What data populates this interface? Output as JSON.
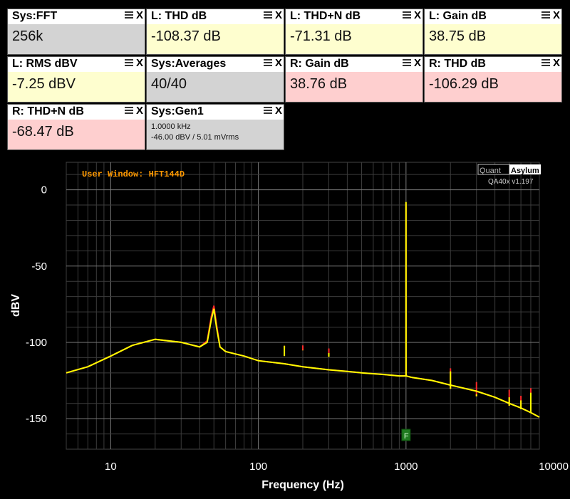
{
  "widgets": [
    {
      "title": "Sys:FFT",
      "value": "256k"
    },
    {
      "title": "L: THD dB",
      "value": "-108.37 dB"
    },
    {
      "title": "L: THD+N dB",
      "value": "-71.31 dB"
    },
    {
      "title": "L: Gain dB",
      "value": "38.75 dB"
    },
    {
      "title": "L: RMS dBV",
      "value": "-7.25 dBV"
    },
    {
      "title": "Sys:Averages",
      "value": "40/40"
    },
    {
      "title": "R: Gain dB",
      "value": "38.76 dB"
    },
    {
      "title": "R: THD dB",
      "value": "-106.29 dB"
    },
    {
      "title": "R: THD+N dB",
      "value": "-68.47 dB"
    },
    {
      "title": "Sys:Gen1",
      "line1": "1.0000 kHz",
      "line2": "-46.00 dBV  / 5.01 mVrms"
    }
  ],
  "close_glyph": "X",
  "colors": {
    "gray": "#d3d3d3",
    "yellow": "#fefecf",
    "pink": "#fecfcf",
    "left_trace": "#ffff00",
    "right_trace": "#ff2a2a",
    "window_label": "#ff9900"
  },
  "chart_data": {
    "type": "line",
    "title": "",
    "window_label": "User Window: HFT144D",
    "brand": {
      "left": "Quant",
      "right": "Asylum",
      "version": "QA40x v1.197"
    },
    "xlabel": "Frequency (Hz)",
    "ylabel": "dBV",
    "x_scale": "log",
    "xlim": [
      5,
      8000
    ],
    "ylim": [
      -170,
      18
    ],
    "xticks": [
      10,
      100,
      1000,
      10000
    ],
    "xtick_labels": [
      "10",
      "100",
      "1000",
      "10000"
    ],
    "yticks": [
      0,
      -50,
      -100,
      -150
    ],
    "ytick_labels": [
      "0",
      "-50",
      "-100",
      "-150"
    ],
    "grid": true,
    "marker": {
      "label": "F",
      "x": 1000
    },
    "series": [
      {
        "channel": "left",
        "x": [
          5,
          7,
          10,
          14,
          20,
          30,
          40,
          45,
          48,
          50,
          52,
          55,
          60,
          80,
          100,
          150,
          200,
          300,
          400,
          500,
          700,
          900,
          999,
          1000,
          1001,
          1100,
          1500,
          2000,
          3000,
          4000,
          5000,
          6000,
          7000,
          8000
        ],
        "y": [
          -120,
          -116,
          -109,
          -102,
          -98,
          -100,
          -103,
          -100,
          -85,
          -78,
          -90,
          -103,
          -106,
          -109,
          -112,
          -114,
          -116,
          -118,
          -119,
          -120,
          -121,
          -122,
          -122,
          -8,
          -122,
          -123,
          -125,
          -128,
          -132,
          -136,
          -140,
          -143,
          -146,
          -149
        ]
      },
      {
        "channel": "right",
        "x": [
          5,
          7,
          10,
          14,
          20,
          30,
          40,
          45,
          48,
          50,
          52,
          55,
          60,
          80,
          100,
          150,
          200,
          300,
          400,
          500,
          700,
          900,
          999,
          1000,
          1001,
          1100,
          1500,
          2000,
          3000,
          4000,
          5000,
          6000,
          7000,
          8000
        ],
        "y": [
          -120,
          -116,
          -109,
          -102,
          -98,
          -100,
          -103,
          -99,
          -83,
          -76,
          -88,
          -103,
          -106,
          -109,
          -112,
          -114,
          -116,
          -118,
          -119,
          -120,
          -121,
          -122,
          -122,
          -9,
          -122,
          -123,
          -125,
          -128,
          -132,
          -136,
          -140,
          -143,
          -146,
          -149
        ]
      },
      {
        "channel": "left",
        "x": [
          150,
          200,
          300,
          2000,
          3000,
          5000,
          6000,
          7000
        ],
        "y": [
          -109,
          -105,
          -107,
          -119,
          -134,
          -136,
          -138,
          -133
        ]
      },
      {
        "channel": "right",
        "x": [
          150,
          200,
          300,
          2000,
          3000,
          5000,
          6000,
          7000
        ],
        "y": [
          -104,
          -102,
          -104,
          -117,
          -126,
          -131,
          -135,
          -130
        ]
      }
    ]
  }
}
